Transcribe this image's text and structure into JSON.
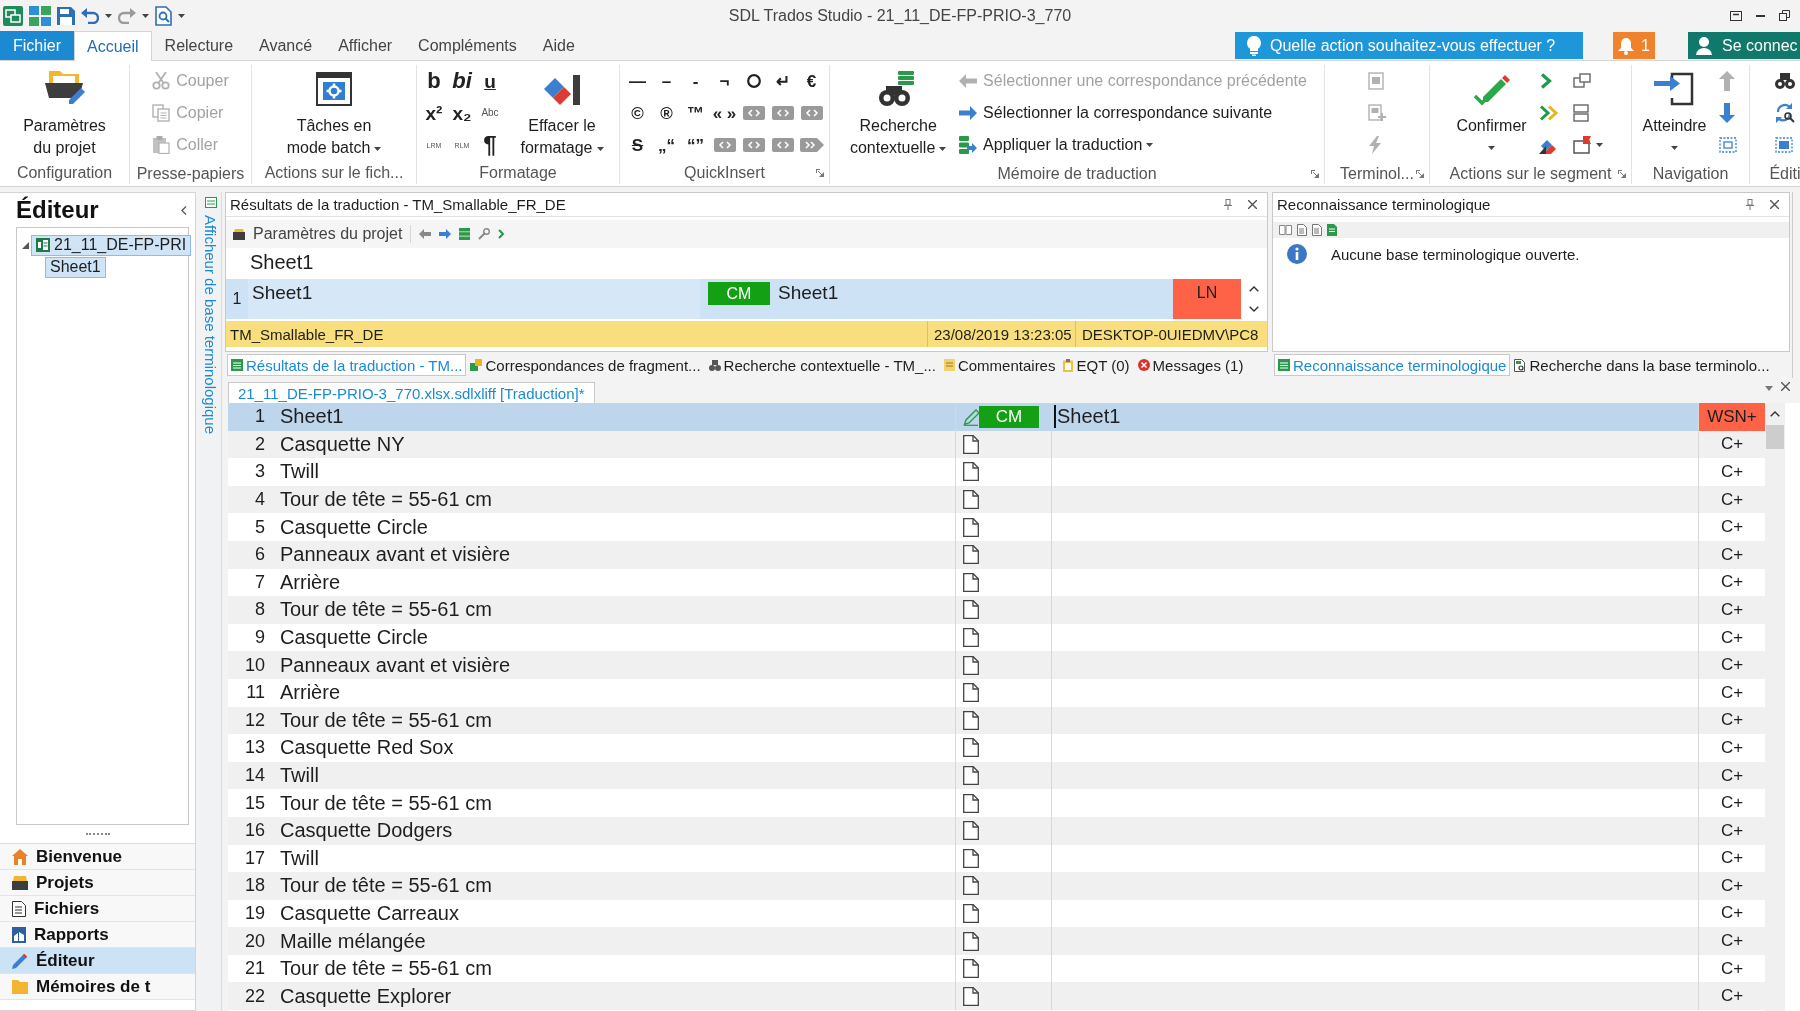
{
  "window": {
    "title": "SDL Trados Studio - 21_11_DE-FP-PRIO-3_770"
  },
  "ribbon_tabs": [
    {
      "label": "Fichier",
      "kind": "backstage",
      "selected": false
    },
    {
      "label": "Accueil",
      "kind": "tab",
      "selected": true
    },
    {
      "label": "Relecture",
      "kind": "tab",
      "selected": false
    },
    {
      "label": "Avancé",
      "kind": "tab",
      "selected": false
    },
    {
      "label": "Afficher",
      "kind": "tab",
      "selected": false
    },
    {
      "label": "Compléments",
      "kind": "tab",
      "selected": false
    },
    {
      "label": "Aide",
      "kind": "tab",
      "selected": false
    }
  ],
  "tell_me": {
    "label": "Quelle action souhaitez-vous effectuer ?"
  },
  "notifications": {
    "count": "1"
  },
  "account": {
    "label": "Se connec"
  },
  "ribbon_groups": [
    {
      "label": "Configuration",
      "launcher": false,
      "items": [
        {
          "kind": "large",
          "label": "Paramètres du projet",
          "disabled": false,
          "menu": false
        }
      ]
    },
    {
      "label": "Presse-papiers",
      "launcher": false,
      "items": [
        {
          "kind": "stack",
          "items": [
            {
              "label": "Couper",
              "disabled": true,
              "menu": false
            },
            {
              "label": "Copier",
              "disabled": true,
              "menu": false
            },
            {
              "label": "Coller",
              "disabled": true,
              "menu": false
            }
          ]
        }
      ]
    },
    {
      "label": "Actions sur le fich...",
      "launcher": false,
      "items": [
        {
          "kind": "large",
          "label": "Tâches en mode batch",
          "disabled": false,
          "menu": true
        }
      ]
    },
    {
      "label": "Formatage",
      "launcher": false,
      "items": [
        {
          "kind": "format-grid",
          "cells": [
            {
              "kind": "char",
              "text": "b"
            },
            {
              "kind": "char",
              "text": "bi"
            },
            {
              "kind": "char",
              "text": "u"
            },
            {
              "kind": "char",
              "text": "x²"
            },
            {
              "kind": "char",
              "text": "x₂"
            },
            {
              "kind": "char",
              "text": "Abc"
            },
            {
              "kind": "char",
              "text": "LRM"
            },
            {
              "kind": "char",
              "text": "RLM"
            },
            {
              "kind": "char",
              "text": "¶"
            }
          ]
        },
        {
          "kind": "large",
          "label": "Effacer le formatage",
          "disabled": false,
          "menu": true
        }
      ]
    },
    {
      "label": "QuickInsert",
      "launcher": true,
      "items": [
        {
          "kind": "symbol-grid",
          "cells": [
            {
              "kind": "char",
              "text": "—"
            },
            {
              "kind": "char",
              "text": "–"
            },
            {
              "kind": "char",
              "text": "-"
            },
            {
              "kind": "char",
              "text": "¬"
            },
            {
              "kind": "circle"
            },
            {
              "kind": "char",
              "text": "↵"
            },
            {
              "kind": "char",
              "text": "€"
            },
            {
              "kind": "char",
              "text": "©"
            },
            {
              "kind": "char",
              "text": "®"
            },
            {
              "kind": "char",
              "text": "™"
            },
            {
              "kind": "char",
              "text": "« »"
            },
            {
              "kind": "tag"
            },
            {
              "kind": "tag"
            },
            {
              "kind": "tag"
            },
            {
              "kind": "strike",
              "text": "S"
            },
            {
              "kind": "char",
              "text": "„“"
            },
            {
              "kind": "char",
              "text": "“”"
            },
            {
              "kind": "tag"
            },
            {
              "kind": "tag"
            },
            {
              "kind": "tag"
            },
            {
              "kind": "tag-arrow"
            }
          ]
        }
      ]
    },
    {
      "label": "Mémoire de traduction",
      "launcher": true,
      "items": [
        {
          "kind": "large",
          "label": "Recherche contextuelle",
          "disabled": false,
          "menu": true
        },
        {
          "kind": "stack",
          "items": [
            {
              "label": "Sélectionner une correspondance précédente",
              "disabled": true,
              "menu": false
            },
            {
              "label": "Sélectionner la correspondance suivante",
              "disabled": false,
              "menu": false
            },
            {
              "label": "Appliquer la traduction",
              "disabled": false,
              "menu": true
            }
          ]
        }
      ]
    },
    {
      "label": "Terminol...",
      "launcher": true,
      "items": [
        {
          "kind": "stack",
          "items": [
            {
              "disabled": true,
              "menu": false
            },
            {
              "disabled": true,
              "menu": false
            },
            {
              "disabled": true,
              "menu": false
            }
          ]
        }
      ]
    },
    {
      "label": "Actions sur le segment",
      "launcher": true,
      "items": [
        {
          "kind": "large",
          "label": "Confirmer",
          "disabled": false,
          "menu": true
        },
        {
          "kind": "stack",
          "items": [
            {
              "disabled": false,
              "menu": false
            },
            {
              "disabled": false,
              "menu": false
            },
            {
              "disabled": false,
              "menu": false
            }
          ]
        },
        {
          "kind": "stack",
          "items": [
            {
              "disabled": false,
              "menu": false
            },
            {
              "disabled": false,
              "menu": false
            },
            {
              "disabled": false,
              "menu": true
            }
          ]
        }
      ]
    },
    {
      "label": "Navigation",
      "launcher": false,
      "items": [
        {
          "kind": "large",
          "label": "Atteindre",
          "disabled": false,
          "menu": true
        },
        {
          "kind": "stack",
          "items": [
            {
              "disabled": true,
              "menu": false
            },
            {
              "disabled": false,
              "menu": false
            },
            {
              "disabled": false,
              "menu": false
            }
          ]
        }
      ]
    },
    {
      "label": "Éditi",
      "launcher": false,
      "items": [
        {
          "kind": "stack",
          "items": [
            {
              "disabled": false,
              "menu": false
            },
            {
              "disabled": false,
              "menu": false
            },
            {
              "disabled": false,
              "menu": false
            }
          ]
        }
      ]
    }
  ],
  "navigation_panel": {
    "title": "Éditeur",
    "tree": [
      {
        "label": "21_11_DE-FP-PRI",
        "expanded": true,
        "selected": true,
        "children": [
          {
            "label": "Sheet1",
            "selected": true
          }
        ]
      }
    ],
    "views": [
      {
        "label": "Bienvenue",
        "selected": false
      },
      {
        "label": "Projets",
        "selected": false
      },
      {
        "label": "Fichiers",
        "selected": false
      },
      {
        "label": "Rapports",
        "selected": false
      },
      {
        "label": "Éditeur",
        "selected": true
      },
      {
        "label": "Mémoires de t",
        "selected": false
      }
    ]
  },
  "side_tab": {
    "label": "Afficheur de base terminologique"
  },
  "translation_results": {
    "title": "Résultats de la traduction - TM_Smallable_FR_DE",
    "toolbar_label": "Paramètres du projet",
    "source": "Sheet1",
    "match": {
      "number": "1",
      "source": "Sheet1",
      "origin": "CM",
      "target": "Sheet1",
      "score": "LN",
      "tm": "TM_Smallable_FR_DE",
      "date": "23/08/2019 13:23:05",
      "user": "DESKTOP-0UIEDMV\\PC8"
    }
  },
  "results_tabs": [
    {
      "label": "Résultats de la traduction - TM...",
      "selected": true
    },
    {
      "label": "Correspondances de fragment...",
      "selected": false
    },
    {
      "label": "Recherche contextuelle - TM_...",
      "selected": false
    },
    {
      "label": "Commentaires",
      "selected": false
    },
    {
      "label": "EQT (0)",
      "selected": false
    },
    {
      "label": "Messages (1)",
      "selected": false
    }
  ],
  "term_recognition": {
    "title": "Reconnaissance terminologique",
    "message": "Aucune base terminologique ouverte."
  },
  "term_tabs": [
    {
      "label": "Reconnaissance terminologique",
      "selected": true
    },
    {
      "label": "Recherche dans la base terminolo...",
      "selected": false
    }
  ],
  "document_tab": {
    "label": "21_11_DE-FP-PRIO-3_770.xlsx.sdlxliff [Traduction]*"
  },
  "segments": [
    {
      "number": "1",
      "source": "Sheet1",
      "kind": "draft",
      "origin": "CM",
      "target": "Sheet1",
      "structure": "WSN+",
      "selected": true
    },
    {
      "number": "2",
      "source": "Casquette NY",
      "kind": "new",
      "structure": "C+",
      "selected": false
    },
    {
      "number": "3",
      "source": "Twill",
      "kind": "new",
      "structure": "C+",
      "selected": false
    },
    {
      "number": "4",
      "source": "Tour de tête = 55-61 cm",
      "kind": "new",
      "structure": "C+",
      "selected": false
    },
    {
      "number": "5",
      "source": "Casquette Circle",
      "kind": "new",
      "structure": "C+",
      "selected": false
    },
    {
      "number": "6",
      "source": "Panneaux avant et visière",
      "kind": "new",
      "structure": "C+",
      "selected": false
    },
    {
      "number": "7",
      "source": "Arrière",
      "kind": "new",
      "structure": "C+",
      "selected": false
    },
    {
      "number": "8",
      "source": "Tour de tête = 55-61 cm",
      "kind": "new",
      "structure": "C+",
      "selected": false
    },
    {
      "number": "9",
      "source": "Casquette Circle",
      "kind": "new",
      "structure": "C+",
      "selected": false
    },
    {
      "number": "10",
      "source": "Panneaux avant et visière",
      "kind": "new",
      "structure": "C+",
      "selected": false
    },
    {
      "number": "11",
      "source": "Arrière",
      "kind": "new",
      "structure": "C+",
      "selected": false
    },
    {
      "number": "12",
      "source": "Tour de tête = 55-61 cm",
      "kind": "new",
      "structure": "C+",
      "selected": false
    },
    {
      "number": "13",
      "source": "Casquette Red Sox",
      "kind": "new",
      "structure": "C+",
      "selected": false
    },
    {
      "number": "14",
      "source": "Twill",
      "kind": "new",
      "structure": "C+",
      "selected": false
    },
    {
      "number": "15",
      "source": "Tour de tête = 55-61 cm",
      "kind": "new",
      "structure": "C+",
      "selected": false
    },
    {
      "number": "16",
      "source": "Casquette Dodgers",
      "kind": "new",
      "structure": "C+",
      "selected": false
    },
    {
      "number": "17",
      "source": "Twill",
      "kind": "new",
      "structure": "C+",
      "selected": false
    },
    {
      "number": "18",
      "source": "Tour de tête = 55-61 cm",
      "kind": "new",
      "structure": "C+",
      "selected": false
    },
    {
      "number": "19",
      "source": "Casquette Carreaux",
      "kind": "new",
      "structure": "C+",
      "selected": false
    },
    {
      "number": "20",
      "source": "Maille mélangée",
      "kind": "new",
      "structure": "C+",
      "selected": false
    },
    {
      "number": "21",
      "source": "Tour de tête = 55-61 cm",
      "kind": "new",
      "structure": "C+",
      "selected": false
    },
    {
      "number": "22",
      "source": "Casquette Explorer",
      "kind": "new",
      "structure": "C+",
      "selected": false
    }
  ]
}
